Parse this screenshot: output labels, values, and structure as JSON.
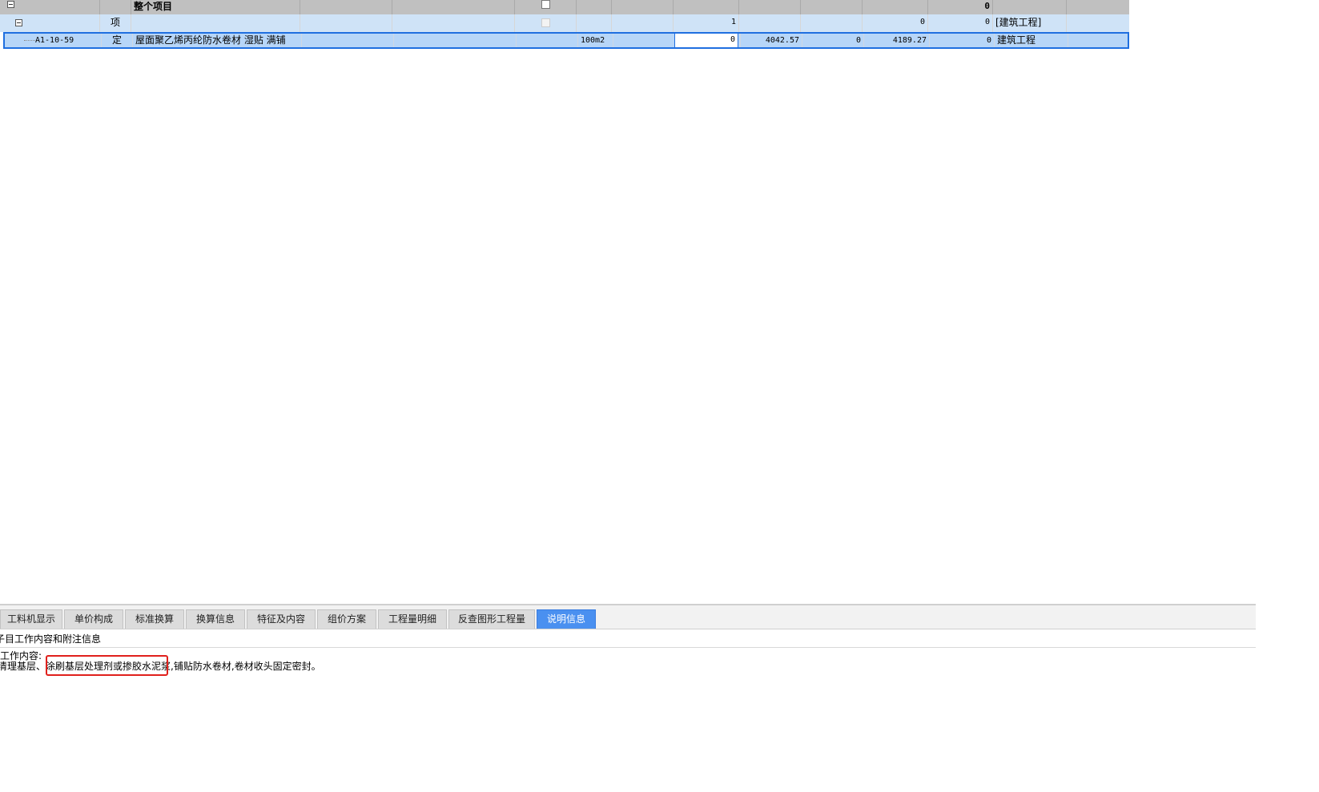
{
  "grid": {
    "root_row": {
      "name": "整个项目",
      "total": "0"
    },
    "group_row": {
      "type": "项",
      "quantity": "1",
      "val_a": "0",
      "val_b": "0",
      "category": "[建筑工程]"
    },
    "item_row": {
      "code": "A1-10-59",
      "type": "定",
      "name": "屋面聚乙烯丙纶防水卷材 湿贴 满铺",
      "unit": "100m2",
      "quantity": "0",
      "unit_price": "4042.57",
      "val_a": "0",
      "price_b": "4189.27",
      "val_b": "0",
      "category": "建筑工程"
    }
  },
  "tabs": [
    {
      "label": "工料机显示",
      "active": false
    },
    {
      "label": "单价构成",
      "active": false
    },
    {
      "label": "标准换算",
      "active": false
    },
    {
      "label": "换算信息",
      "active": false
    },
    {
      "label": "特征及内容",
      "active": false
    },
    {
      "label": "组价方案",
      "active": false
    },
    {
      "label": "工程量明细",
      "active": false
    },
    {
      "label": "反查图形工程量",
      "active": false
    },
    {
      "label": "说明信息",
      "active": true
    }
  ],
  "info": {
    "header": "子目工作内容和附注信息",
    "work_label": "工作内容:",
    "work_text": "清理基层、涂刷基层处理剂或掺胶水泥浆,铺贴防水卷材,卷材收头固定密封。"
  },
  "colors": {
    "accent": "#1f6fe0",
    "active_tab": "#4a90f0",
    "highlight_border": "#e0201c"
  }
}
